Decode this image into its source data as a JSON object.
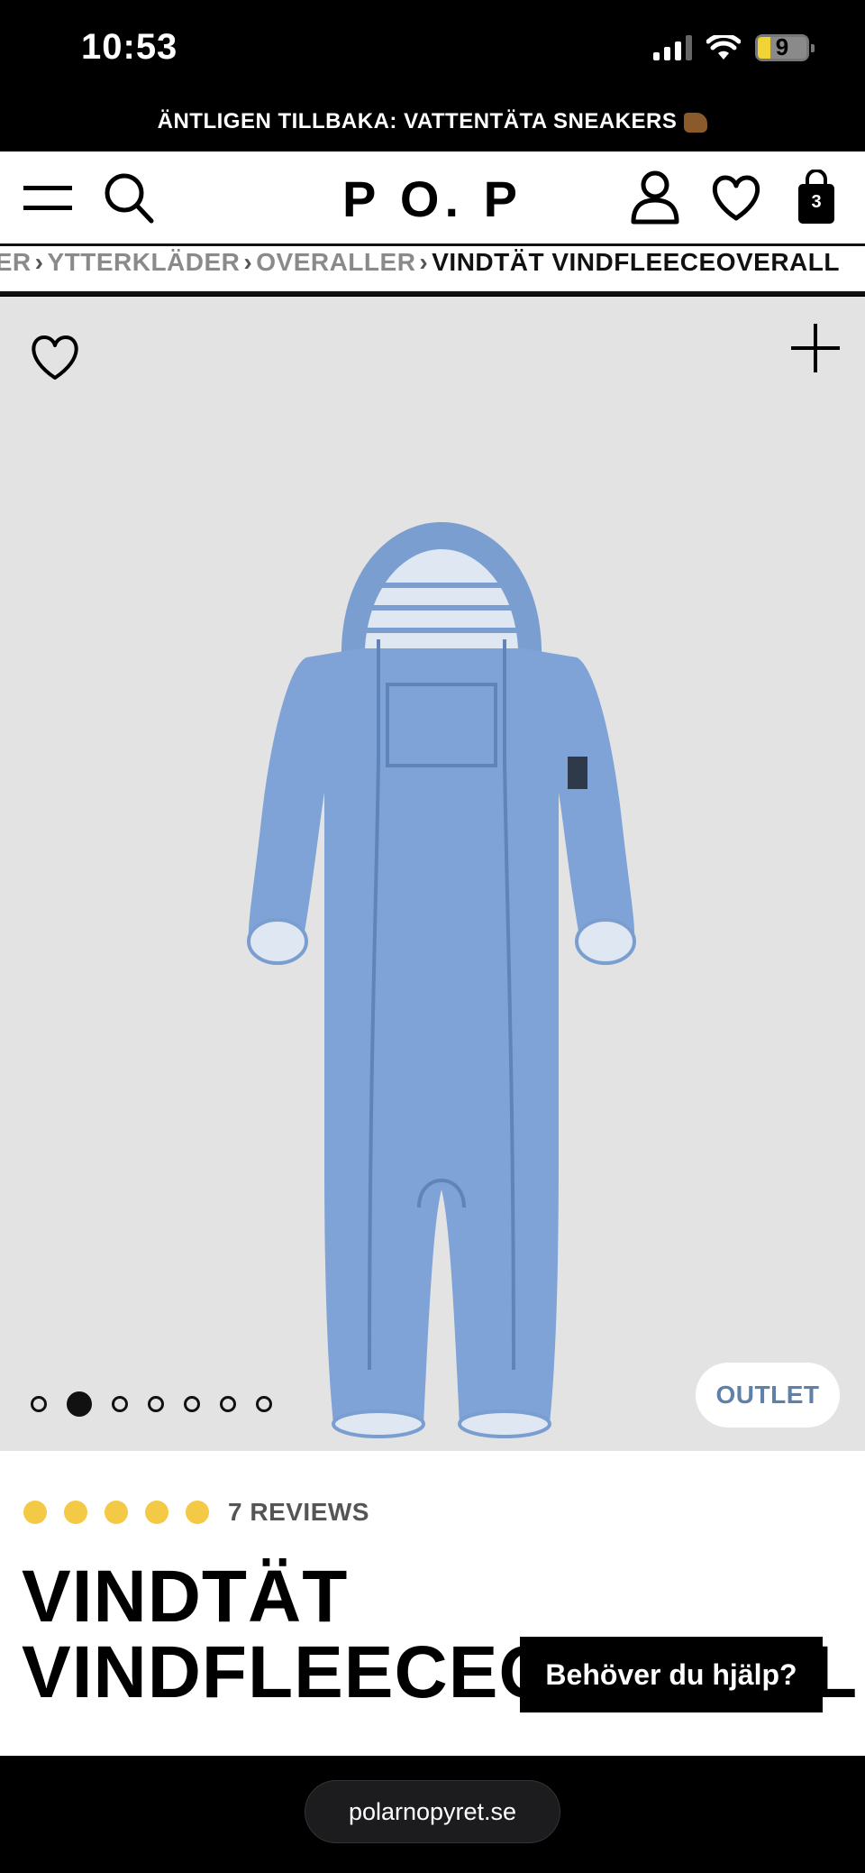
{
  "status_bar": {
    "time": "10:53",
    "battery": "9"
  },
  "promo": {
    "text": "ÄNTLIGEN TILLBAKA: VATTENTÄTA SNEAKERS"
  },
  "header": {
    "logo": "P O. P",
    "cart_count": "3"
  },
  "breadcrumb": {
    "items": [
      "DER",
      "YTTERKLÄDER",
      "OVERALLER"
    ],
    "current": "VINDTÄT VINDFLEECEOVERALL"
  },
  "gallery": {
    "image_count": 7,
    "active_index": 1,
    "badge": "OUTLET",
    "product_color": "#7fa3d6"
  },
  "product": {
    "rating_dots": 5,
    "reviews": "7 REVIEWS",
    "title_line1": "VINDTÄT",
    "title_line2": "VINDFLEECEOVERALL"
  },
  "help": {
    "label": "Behöver du hjälp?"
  },
  "browser": {
    "url": "polarnopyret.se"
  },
  "colors": {
    "accent_star": "#f3c945",
    "outlet_text": "#5f80a8",
    "background_gallery": "#e3e3e4"
  }
}
